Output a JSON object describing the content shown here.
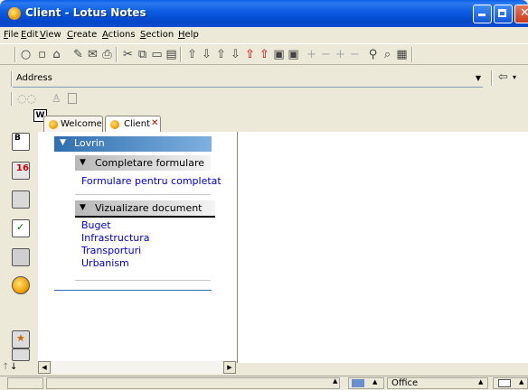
{
  "window": {
    "title": "Client - Lotus Notes"
  },
  "menu": [
    "File",
    "Edit",
    "View",
    "Create",
    "Actions",
    "Section",
    "Help"
  ],
  "address": {
    "label": "Address",
    "value": ""
  },
  "tabs": [
    {
      "label": "Welcome"
    },
    {
      "label": "Client"
    }
  ],
  "nav": {
    "root": "Lovrin",
    "sections": [
      {
        "title": "Completare formulare",
        "links": [
          "Formulare pentru completat"
        ]
      },
      {
        "title": "Vizualizare document",
        "links": [
          "Buget",
          "Infrastructura",
          "Transporturi",
          "Urbanism"
        ]
      }
    ]
  },
  "status": {
    "location": "Office"
  },
  "colors": {
    "title_bar": "#0a4fd0",
    "nav_header": "#2f6fae",
    "link": "#0000cc"
  }
}
